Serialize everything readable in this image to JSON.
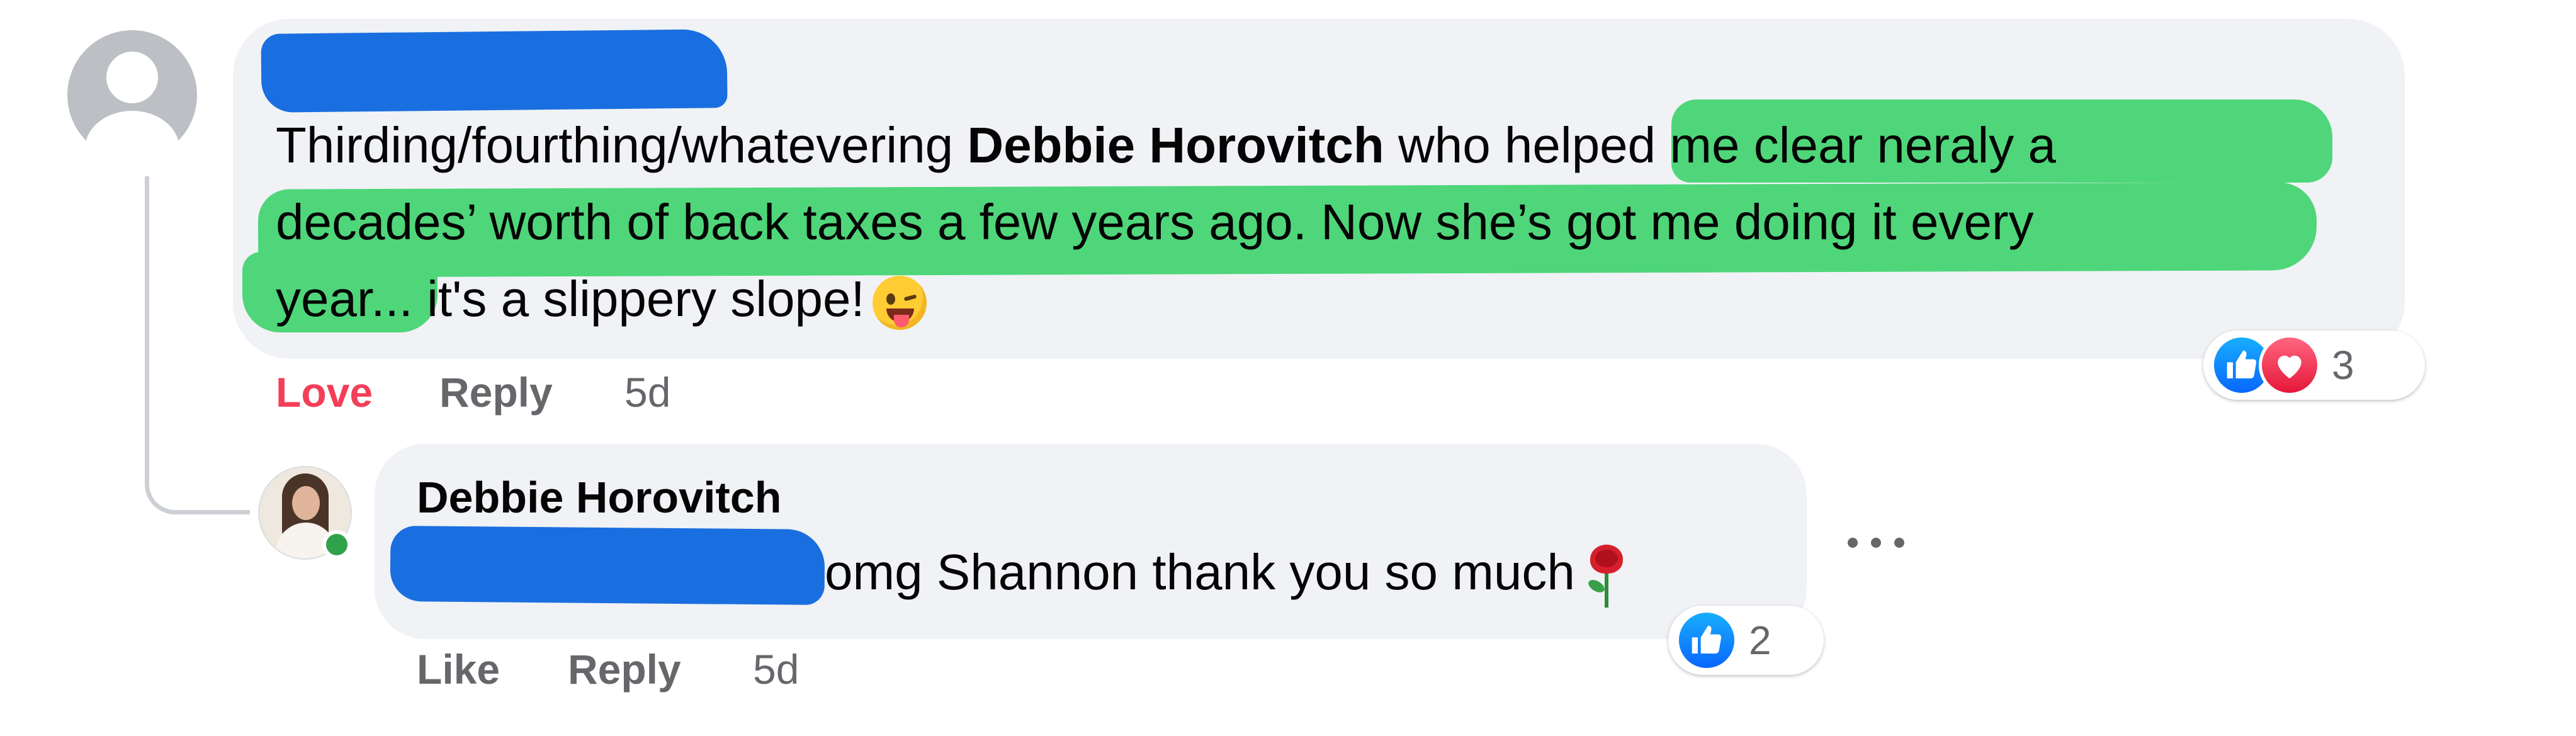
{
  "comment1": {
    "text_before": "Thirding/fourthing/whatevering ",
    "mention": "Debbie Horovitch",
    "line1_rest": " who helped me clear neraly a",
    "line2": "decades’ worth of back taxes a few years ago. Now she’s got me doing it every",
    "line3": "year... it's a slippery slope!",
    "emoji": "winking-face-with-tongue",
    "actions": {
      "love": "Love",
      "reply": "Reply",
      "time": "5d"
    },
    "reactions": {
      "types": [
        "like",
        "love"
      ],
      "count": "3"
    }
  },
  "reply1": {
    "author": "Debbie Horovitch",
    "text": "omg Shannon thank you so much",
    "emoji": "rose",
    "actions": {
      "like": "Like",
      "reply": "Reply",
      "time": "5d"
    },
    "reactions": {
      "types": [
        "like"
      ],
      "count": "2"
    }
  },
  "colors": {
    "bubble": "#f0f2f5",
    "secondary_text": "#65676b",
    "love_action": "#f33e58",
    "redaction": "#1a6fe0",
    "highlight": "#4fd67a",
    "online": "#31a24c"
  }
}
